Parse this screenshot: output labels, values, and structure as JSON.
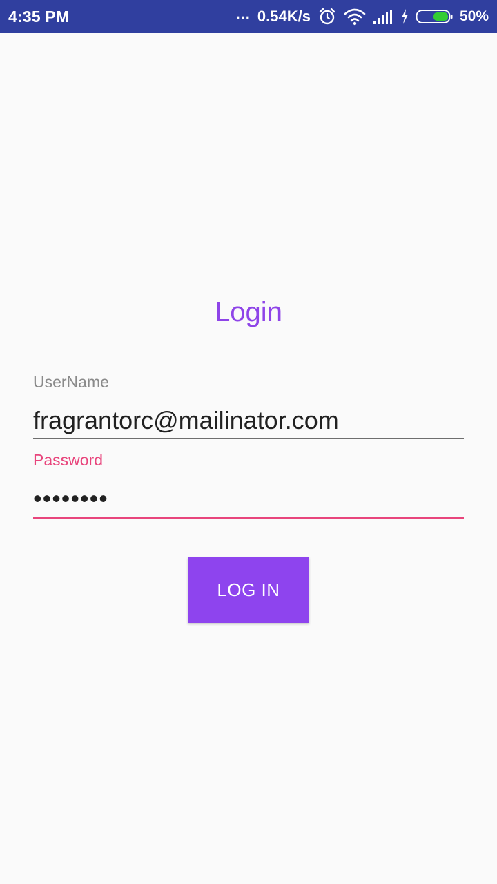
{
  "status_bar": {
    "time": "4:35 PM",
    "dots": "...",
    "network_speed": "0.54K/s",
    "battery_percent": "50%",
    "icons": [
      "alarm-icon",
      "wifi-icon",
      "signal-icon",
      "charging-icon",
      "battery-icon"
    ],
    "background_color": "#303f9f"
  },
  "login": {
    "title": "Login",
    "title_color": "#8e44e8",
    "username": {
      "label": "UserName",
      "value": "fragrantorc@mailinator.com"
    },
    "password": {
      "label": "Password",
      "value": "••••••••",
      "accent_color": "#e8457c"
    },
    "button_label": "LOG IN",
    "button_color": "#8e44ee"
  }
}
